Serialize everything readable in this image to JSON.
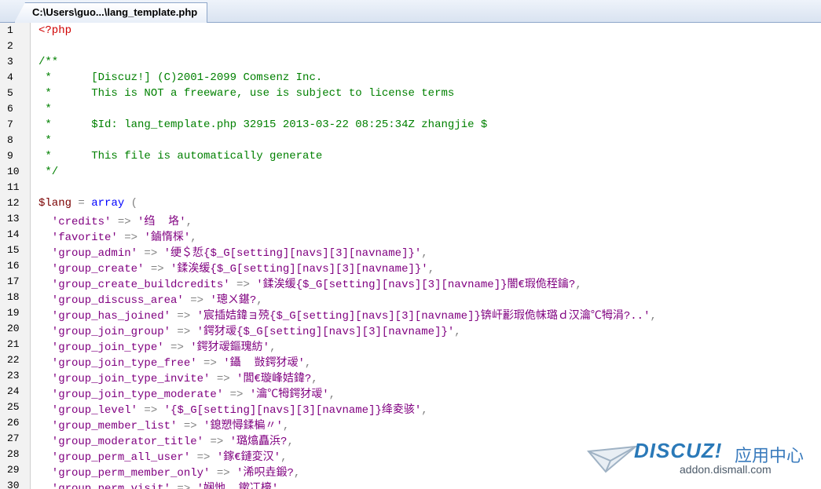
{
  "tab": {
    "title": "C:\\Users\\guo...\\lang_template.php"
  },
  "lines": [
    [
      {
        "t": "php",
        "s": "<?php"
      }
    ],
    [],
    [
      {
        "t": "cm",
        "s": "/**"
      }
    ],
    [
      {
        "t": "cm",
        "s": " *      [Discuz!] (C)2001-2099 Comsenz Inc."
      }
    ],
    [
      {
        "t": "cm",
        "s": " *      This is NOT a freeware, use is subject to license terms"
      }
    ],
    [
      {
        "t": "cm",
        "s": " *"
      }
    ],
    [
      {
        "t": "cm",
        "s": " *      $Id: lang_template.php 32915 2013-03-22 08:25:34Z zhangjie $"
      }
    ],
    [
      {
        "t": "cm",
        "s": " *"
      }
    ],
    [
      {
        "t": "cm",
        "s": " *      This file is automatically generate"
      }
    ],
    [
      {
        "t": "cm",
        "s": " */"
      }
    ],
    [],
    [
      {
        "t": "var",
        "s": "$lang"
      },
      {
        "t": "op",
        "s": " = "
      },
      {
        "t": "kw",
        "s": "array"
      },
      {
        "t": "op",
        "s": " ("
      }
    ],
    [
      {
        "t": "str",
        "s": "  'credits'"
      },
      {
        "t": "op",
        "s": " => "
      },
      {
        "t": "str",
        "s": "'绉  垎'"
      },
      {
        "t": "op",
        "s": ","
      }
    ],
    [
      {
        "t": "str",
        "s": "  'favorite'"
      },
      {
        "t": "op",
        "s": " => "
      },
      {
        "t": "str",
        "s": "'鏀惰棌'"
      },
      {
        "t": "op",
        "s": ","
      }
    ],
    [
      {
        "t": "str",
        "s": "  'group_admin'"
      },
      {
        "t": "op",
        "s": " => "
      },
      {
        "t": "str",
        "s": "'绠＄悊{$_G[setting][navs][3][navname]}'"
      },
      {
        "t": "op",
        "s": ","
      }
    ],
    [
      {
        "t": "str",
        "s": "  'group_create'"
      },
      {
        "t": "op",
        "s": " => "
      },
      {
        "t": "str",
        "s": "'鍒涘缓{$_G[setting][navs][3][navname]}'"
      },
      {
        "t": "op",
        "s": ","
      }
    ],
    [
      {
        "t": "str",
        "s": "  'group_create_buildcredits'"
      },
      {
        "t": "op",
        "s": " => "
      },
      {
        "t": "str",
        "s": "'鍒涘缓{$_G[setting][navs][3][navname]}闇€瑕佹秷鑰?"
      },
      {
        "t": "op",
        "s": ","
      }
    ],
    [
      {
        "t": "str",
        "s": "  'group_discuss_area'"
      },
      {
        "t": "op",
        "s": " => "
      },
      {
        "t": "str",
        "s": "'璁ㄨ鍖?"
      },
      {
        "t": "op",
        "s": ","
      }
    ],
    [
      {
        "t": "str",
        "s": "  'group_has_joined'"
      },
      {
        "t": "op",
        "s": " => "
      },
      {
        "t": "str",
        "s": "'宸插姞鍏ョ殑{$_G[setting][navs][3][navname]}锛屽彲瑕佹帓璐ｄ汉瀹℃牳涓?..'"
      },
      {
        "t": "op",
        "s": ","
      }
    ],
    [
      {
        "t": "str",
        "s": "  'group_join_group'"
      },
      {
        "t": "op",
        "s": " => "
      },
      {
        "t": "str",
        "s": "'鍔犲叆{$_G[setting][navs][3][navname]}'"
      },
      {
        "t": "op",
        "s": ","
      }
    ],
    [
      {
        "t": "str",
        "s": "  'group_join_type'"
      },
      {
        "t": "op",
        "s": " => "
      },
      {
        "t": "str",
        "s": "'鍔犲叆鏂瑰紡'"
      },
      {
        "t": "op",
        "s": ","
      }
    ],
    [
      {
        "t": "str",
        "s": "  'group_join_type_free'"
      },
      {
        "t": "op",
        "s": " => "
      },
      {
        "t": "str",
        "s": "'鑷  敱鍔犲叆'"
      },
      {
        "t": "op",
        "s": ","
      }
    ],
    [
      {
        "t": "str",
        "s": "  'group_join_type_invite'"
      },
      {
        "t": "op",
        "s": " => "
      },
      {
        "t": "str",
        "s": "'閭€璇峰姞鍏?"
      },
      {
        "t": "op",
        "s": ","
      }
    ],
    [
      {
        "t": "str",
        "s": "  'group_join_type_moderate'"
      },
      {
        "t": "op",
        "s": " => "
      },
      {
        "t": "str",
        "s": "'瀹℃牳鍔犲叆'"
      },
      {
        "t": "op",
        "s": ","
      }
    ],
    [
      {
        "t": "str",
        "s": "  'group_level'"
      },
      {
        "t": "op",
        "s": " => "
      },
      {
        "t": "str",
        "s": "'{$_G[setting][navs][3][navname]}绛夌骇'"
      },
      {
        "t": "op",
        "s": ","
      }
    ],
    [
      {
        "t": "str",
        "s": "  'group_member_list'"
      },
      {
        "t": "op",
        "s": " => "
      },
      {
        "t": "str",
        "s": "'鎴愬憳鍒楄〃'"
      },
      {
        "t": "op",
        "s": ","
      }
    ],
    [
      {
        "t": "str",
        "s": "  'group_moderator_title'"
      },
      {
        "t": "op",
        "s": " => "
      },
      {
        "t": "str",
        "s": "'璐熻矗浜?"
      },
      {
        "t": "op",
        "s": ","
      }
    ],
    [
      {
        "t": "str",
        "s": "  'group_perm_all_user'"
      },
      {
        "t": "op",
        "s": " => "
      },
      {
        "t": "str",
        "s": "'鎵€鏈変汉'"
      },
      {
        "t": "op",
        "s": ","
      }
    ],
    [
      {
        "t": "str",
        "s": "  'group_perm_member_only'"
      },
      {
        "t": "op",
        "s": " => "
      },
      {
        "t": "str",
        "s": "'浠呮垚鍛?"
      },
      {
        "t": "op",
        "s": ","
      }
    ],
    [
      {
        "t": "str",
        "s": "  'group_perm_visit'"
      },
      {
        "t": "op",
        "s": " => "
      },
      {
        "t": "str",
        "s": "'娴忚  鏉冮檺'"
      }
    ]
  ],
  "watermark": {
    "logo": "DISCUZ!",
    "cn": "应用中心",
    "url": "addon.dismall.com"
  },
  "colors": {
    "comment": "#008000",
    "keyword": "#0000ff",
    "string": "#800080",
    "variable": "#7a0000",
    "php_tag": "#d00000"
  }
}
